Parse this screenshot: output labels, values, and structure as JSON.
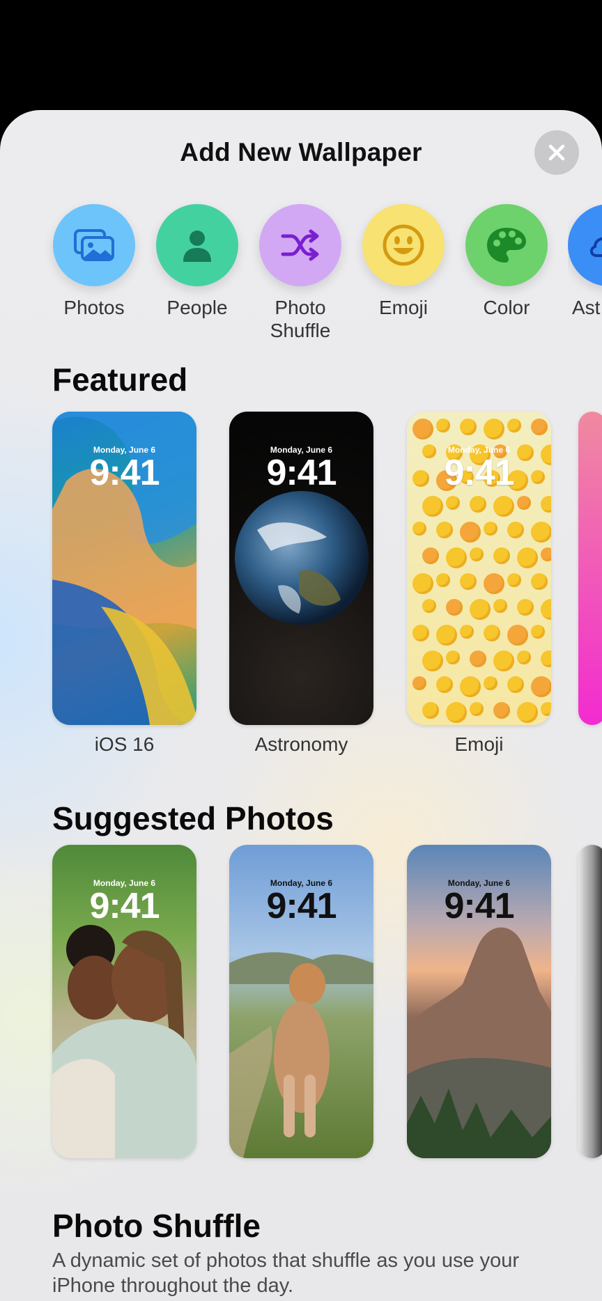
{
  "header": {
    "title": "Add New Wallpaper",
    "close_icon": "close-icon"
  },
  "categories": [
    {
      "label": "Photos",
      "icon": "photos-icon",
      "color": "#6cc4fb"
    },
    {
      "label": "People",
      "icon": "person-icon",
      "color": "#44d1a0"
    },
    {
      "label": "Photo\nShuffle",
      "icon": "shuffle-icon",
      "color": "#d2a8f5"
    },
    {
      "label": "Emoji",
      "icon": "smiley-icon",
      "color": "#f7e272"
    },
    {
      "label": "Color",
      "icon": "palette-icon",
      "color": "#6dd26b"
    },
    {
      "label": "Ast",
      "icon": "cloud-icon",
      "color": "#3b8ef5"
    }
  ],
  "featured": {
    "title": "Featured",
    "items": [
      {
        "caption": "iOS 16",
        "date": "Monday, June 6",
        "time": "9:41"
      },
      {
        "caption": "Astronomy",
        "date": "Monday, June 6",
        "time": "9:41"
      },
      {
        "caption": "Emoji",
        "date": "Monday, June 6",
        "time": "9:41"
      }
    ]
  },
  "suggested": {
    "title": "Suggested Photos",
    "items": [
      {
        "date": "Monday, June 6",
        "time": "9:41"
      },
      {
        "date": "Monday, June 6",
        "time": "9:41"
      },
      {
        "date": "Monday, June 6",
        "time": "9:41"
      }
    ]
  },
  "shuffle": {
    "title": "Photo Shuffle",
    "description": "A dynamic set of photos that shuffle as you use your iPhone throughout the day."
  }
}
